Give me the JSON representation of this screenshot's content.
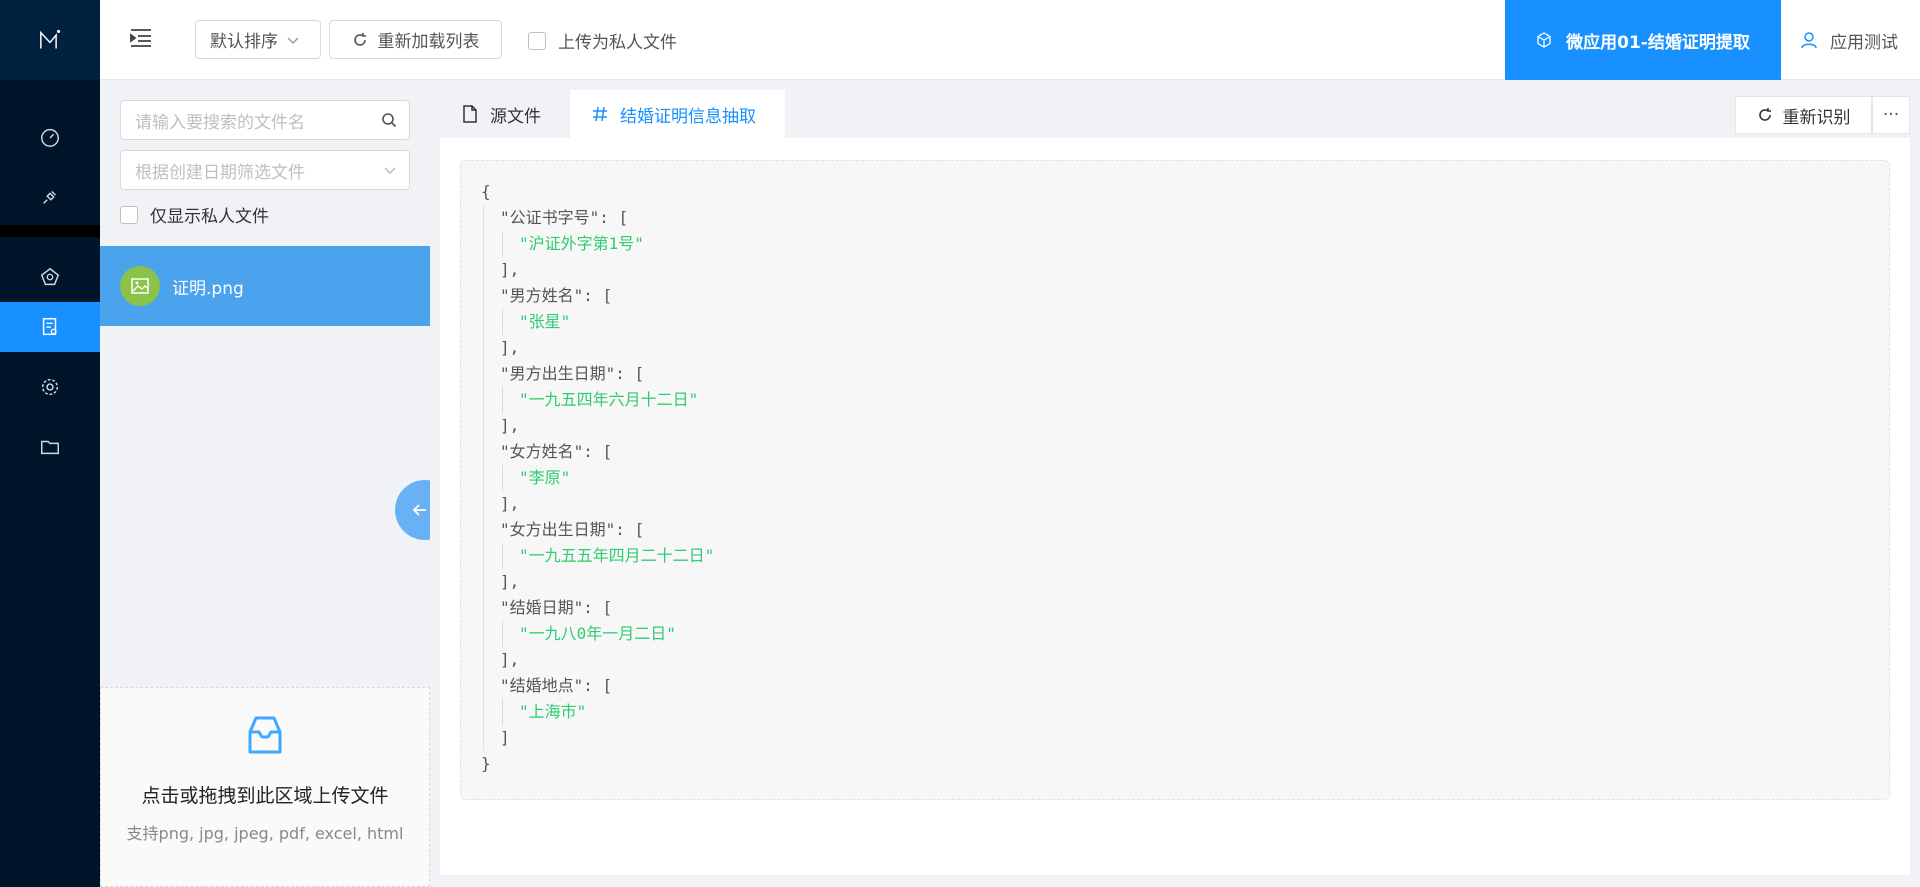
{
  "nav": {
    "logo": "logo-icon",
    "items": [
      "dashboard-icon",
      "plugin-icon",
      "model-icon",
      "document-audit-icon",
      "settings-icon",
      "folder-icon"
    ],
    "active_index": 3
  },
  "header": {
    "sort_label": "默认排序",
    "reload_label": "重新加载列表",
    "upload_private_label": "上传为私人文件",
    "app_name": "微应用01-结婚证明提取",
    "user_name": "应用测试"
  },
  "files": {
    "search_placeholder": "请输入要搜索的文件名",
    "date_placeholder": "根据创建日期筛选文件",
    "only_private_label": "仅显示私人文件",
    "items": [
      {
        "name": "证明.png"
      }
    ],
    "upload_title": "点击或拖拽到此区域上传文件",
    "upload_hint": "支持png, jpg, jpeg, pdf, excel, html"
  },
  "main": {
    "tabs": [
      {
        "label": "源文件",
        "icon": "file-icon"
      },
      {
        "label": "结婚证明信息抽取",
        "icon": "hash-icon"
      }
    ],
    "active_tab": 1,
    "recognize_label": "重新识别",
    "more_label": "···"
  },
  "result": {
    "fields": [
      {
        "key": "公证书字号",
        "values": [
          "沪证外字第1号"
        ]
      },
      {
        "key": "男方姓名",
        "values": [
          "张星"
        ]
      },
      {
        "key": "男方出生日期",
        "values": [
          "一九五四年六月十二日"
        ]
      },
      {
        "key": "女方姓名",
        "values": [
          "李原"
        ]
      },
      {
        "key": "女方出生日期",
        "values": [
          "一九五五年四月二十二日"
        ]
      },
      {
        "key": "结婚日期",
        "values": [
          "一九八0年一月二日"
        ]
      },
      {
        "key": "结婚地点",
        "values": [
          "上海市"
        ]
      }
    ]
  },
  "colors": {
    "accent": "#1890ff",
    "nav_bg": "#001529",
    "string": "#2ecc71"
  }
}
